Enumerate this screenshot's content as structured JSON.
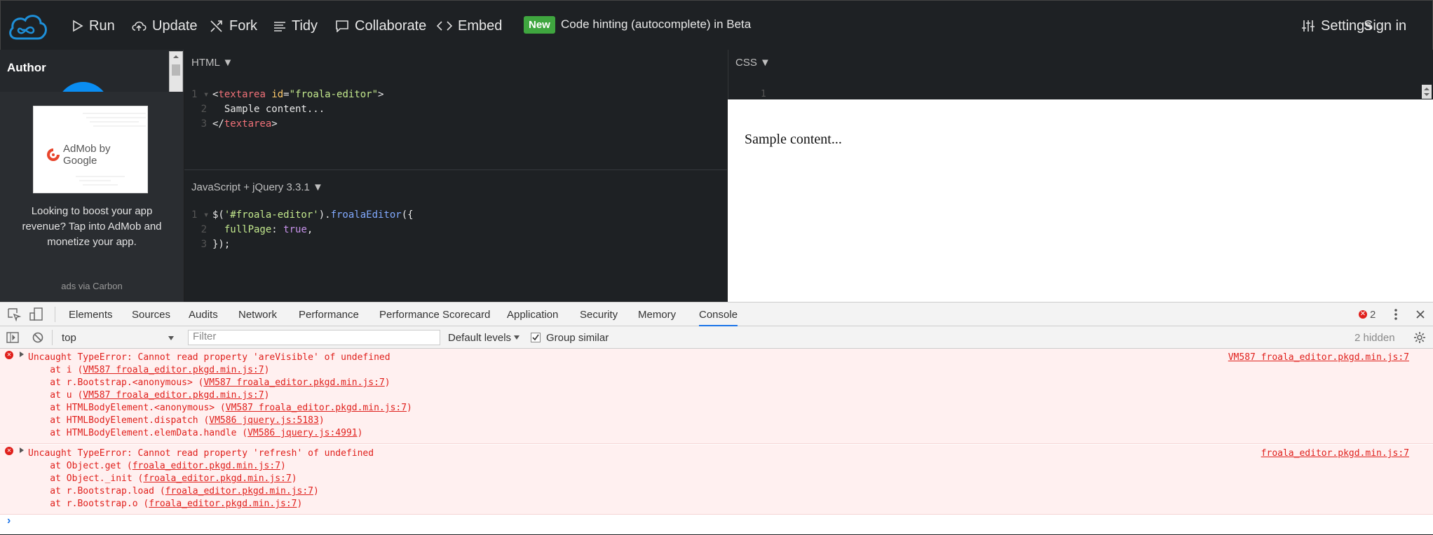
{
  "nav": {
    "run": "Run",
    "update": "Update",
    "fork": "Fork",
    "tidy": "Tidy",
    "collaborate": "Collaborate",
    "embed": "Embed",
    "badge": "New",
    "beta_text": "Code hinting (autocomplete) in Beta",
    "settings": "Settings",
    "signin": "Sign in"
  },
  "sidebar": {
    "author_title": "Author",
    "ad_brand": "AdMob by Google",
    "ad_text": "Looking to boost your app revenue? Tap into AdMob and monetize your app.",
    "ad_via": "ads via Carbon"
  },
  "html_pane": {
    "title": "HTML ▼"
  },
  "css_pane": {
    "title": "CSS ▼",
    "line_number": "1"
  },
  "js_pane": {
    "title": "JavaScript + jQuery 3.3.1 ▼"
  },
  "preview": {
    "text": "Sample content..."
  },
  "devtools": {
    "tabs": [
      "Elements",
      "Sources",
      "Audits",
      "Network",
      "Performance",
      "Performance Scorecard",
      "Application",
      "Security",
      "Memory",
      "Console"
    ],
    "active_tab": "Console",
    "error_count": "2",
    "context": "top",
    "filter_placeholder": "Filter",
    "levels": "Default levels",
    "group_similar": "Group similar",
    "hidden": "2 hidden"
  },
  "console": {
    "errors": [
      {
        "message": "Uncaught TypeError: Cannot read property 'areVisible' of undefined",
        "source": "VM587 froala_editor.pkgd.min.js:7",
        "stack": [
          {
            "pre": "    at i (",
            "link": "VM587 froala_editor.pkgd.min.js:7",
            "post": ")"
          },
          {
            "pre": "    at r.Bootstrap.<anonymous> (",
            "link": "VM587 froala_editor.pkgd.min.js:7",
            "post": ")"
          },
          {
            "pre": "    at u (",
            "link": "VM587 froala_editor.pkgd.min.js:7",
            "post": ")"
          },
          {
            "pre": "    at HTMLBodyElement.<anonymous> (",
            "link": "VM587 froala_editor.pkgd.min.js:7",
            "post": ")"
          },
          {
            "pre": "    at HTMLBodyElement.dispatch (",
            "link": "VM586 jquery.js:5183",
            "post": ")"
          },
          {
            "pre": "    at HTMLBodyElement.elemData.handle (",
            "link": "VM586 jquery.js:4991",
            "post": ")"
          }
        ]
      },
      {
        "message": "Uncaught TypeError: Cannot read property 'refresh' of undefined",
        "source": "froala_editor.pkgd.min.js:7",
        "stack": [
          {
            "pre": "    at Object.get (",
            "link": "froala_editor.pkgd.min.js:7",
            "post": ")"
          },
          {
            "pre": "    at Object._init (",
            "link": "froala_editor.pkgd.min.js:7",
            "post": ")"
          },
          {
            "pre": "    at r.Bootstrap.load (",
            "link": "froala_editor.pkgd.min.js:7",
            "post": ")"
          },
          {
            "pre": "    at r.Bootstrap.o (",
            "link": "froala_editor.pkgd.min.js:7",
            "post": ")"
          }
        ]
      }
    ],
    "prompt": "›"
  }
}
